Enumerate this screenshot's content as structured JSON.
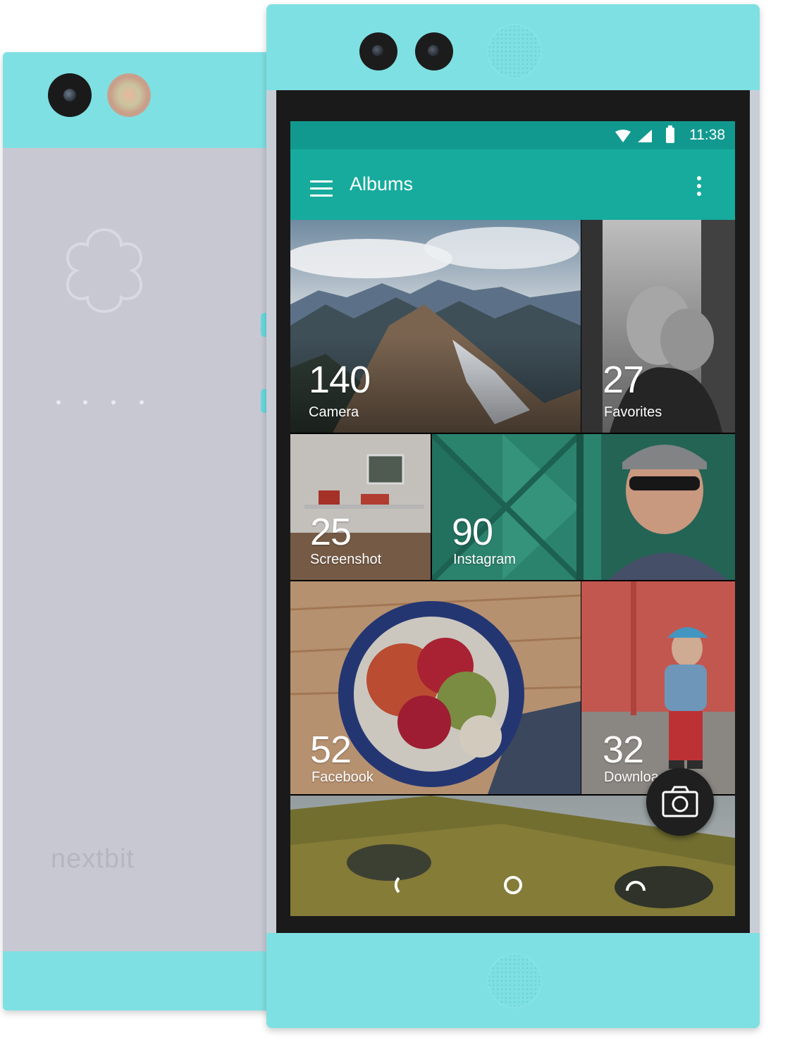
{
  "device": {
    "brand": "nextbit",
    "body_color": "#c7c8d2",
    "accent_color": "#7fe0e3"
  },
  "status_bar": {
    "time": "11:38",
    "icons": [
      "wifi-icon",
      "signal-icon",
      "battery-icon"
    ],
    "color": "#12998f"
  },
  "app_bar": {
    "title": "Albums",
    "menu_icon": "menu-icon",
    "overflow_icon": "more-vert-icon",
    "color": "#16ab9d"
  },
  "albums": [
    {
      "name": "Camera",
      "count": "140"
    },
    {
      "name": "Favorites",
      "count": "27"
    },
    {
      "name": "Screenshot",
      "count": "25"
    },
    {
      "name": "Instagram",
      "count": "90"
    },
    {
      "name": "Facebook",
      "count": "52"
    },
    {
      "name": "Downloa",
      "count": "32"
    }
  ],
  "fab": {
    "icon": "camera-icon"
  },
  "nav_bar": {
    "icons": [
      "back-icon",
      "home-icon",
      "recents-icon"
    ]
  }
}
